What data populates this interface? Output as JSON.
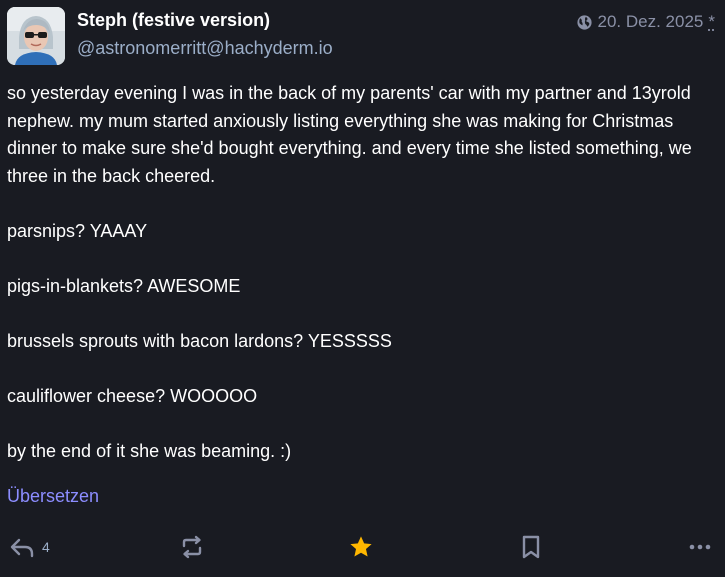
{
  "author": {
    "display_name": "Steph (festive version)",
    "handle": "@astronomerritt@hachyderm.io",
    "avatar_icon": "profile-photo"
  },
  "meta": {
    "visibility_icon": "globe-icon",
    "date": "20. Dez. 2025",
    "edited_marker": "*"
  },
  "content": {
    "paragraphs": [
      "so yesterday evening I was in the back of my parents' car with my partner and 13yrold nephew. my mum started anxiously listing everything she was making for Christmas dinner to make sure she'd bought everything. and every time she listed something, we three in the back cheered.",
      "parsnips? YAAAY",
      "pigs-in-blankets? AWESOME",
      "brussels sprouts with bacon lardons? YESSSSS",
      "cauliflower cheese? WOOOOO",
      "by the end of it she was beaming. :)"
    ]
  },
  "translate_label": "Übersetzen",
  "actions": {
    "reply_count": "4",
    "reply_icon": "reply-icon",
    "boost_icon": "boost-icon",
    "favourite_icon": "star-icon",
    "bookmark_icon": "bookmark-icon",
    "more_icon": "more-icon"
  },
  "colors": {
    "background": "#191b22",
    "text": "#ffffff",
    "secondary_text": "#9baec8",
    "link": "#8c8dff",
    "icon": "#8a90a6",
    "favourite_active": "#ca8f04"
  }
}
